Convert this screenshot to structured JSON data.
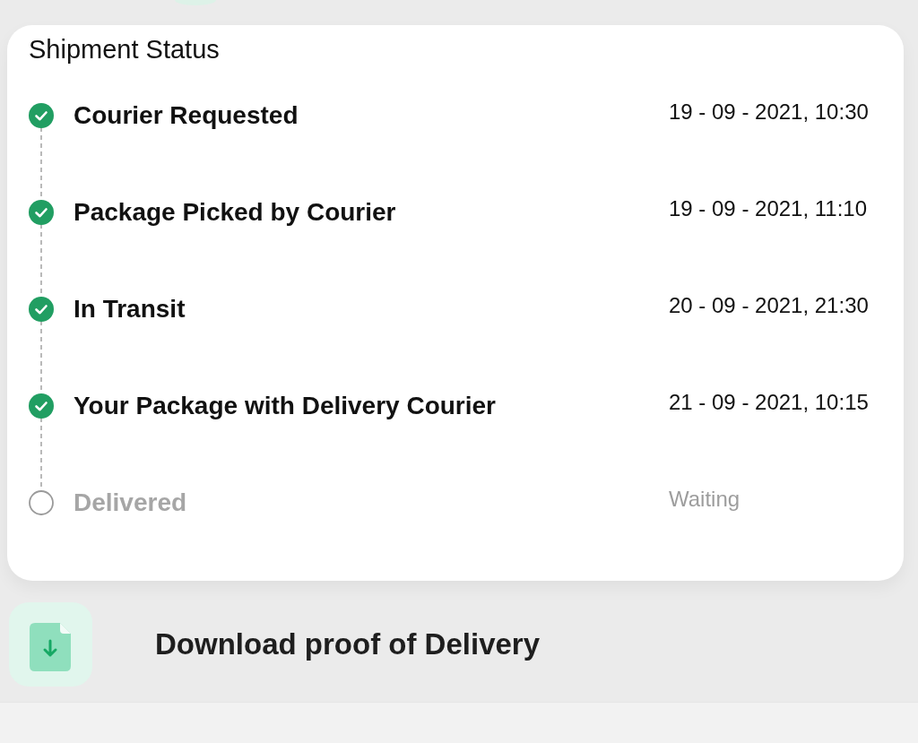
{
  "card": {
    "title": "Shipment Status",
    "steps": [
      {
        "label": "Courier Requested",
        "time": "19 - 09 - 2021, 10:30",
        "done": true
      },
      {
        "label": "Package Picked by Courier",
        "time": "19 - 09 - 2021, 11:10",
        "done": true
      },
      {
        "label": "In Transit",
        "time": "20 - 09 - 2021, 21:30",
        "done": true
      },
      {
        "label": "Your Package with Delivery Courier",
        "time": "21 - 09 - 2021, 10:15",
        "done": true
      },
      {
        "label": "Delivered",
        "time": "Waiting",
        "done": false
      }
    ]
  },
  "download": {
    "label": "Download proof of Delivery"
  }
}
